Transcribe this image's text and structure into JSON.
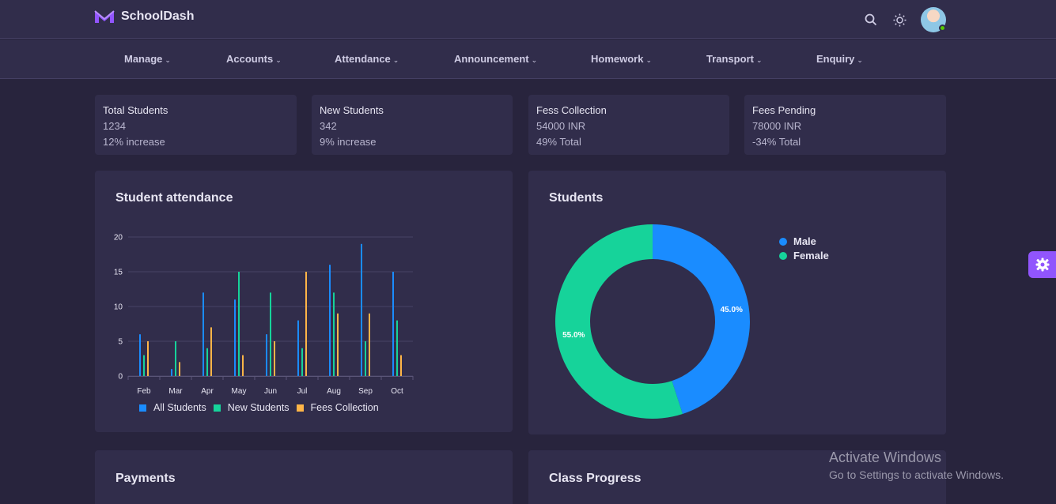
{
  "app": {
    "name": "SchoolDash"
  },
  "nav": [
    {
      "label": "Manage"
    },
    {
      "label": "Accounts"
    },
    {
      "label": "Attendance"
    },
    {
      "label": "Announcement"
    },
    {
      "label": "Homework"
    },
    {
      "label": "Transport"
    },
    {
      "label": "Enquiry"
    }
  ],
  "stats": [
    {
      "label": "Total Students",
      "value": "1234",
      "sub": "12% increase"
    },
    {
      "label": "New Students",
      "value": "342",
      "sub": "9% increase"
    },
    {
      "label": "Fess Collection",
      "value": "54000 INR",
      "sub": "49% Total"
    },
    {
      "label": "Fees Pending",
      "value": "78000 INR",
      "sub": "-34% Total"
    }
  ],
  "cards": {
    "attendance": "Student attendance",
    "students": "Students",
    "payments": "Payments",
    "class_progress": "Class Progress"
  },
  "colors": {
    "blue": "#1a8cff",
    "green": "#16d39a",
    "orange": "#ffb547",
    "accent": "#9155fd"
  },
  "chart_data": [
    {
      "type": "bar",
      "title": "Student attendance",
      "categories": [
        "Feb",
        "Mar",
        "Apr",
        "May",
        "Jun",
        "Jul",
        "Aug",
        "Sep",
        "Oct"
      ],
      "series": [
        {
          "name": "All Students",
          "values": [
            6,
            1,
            12,
            11,
            6,
            8,
            16,
            19,
            15
          ]
        },
        {
          "name": "New Students",
          "values": [
            3,
            5,
            4,
            15,
            12,
            4,
            12,
            5,
            8
          ]
        },
        {
          "name": "Fees Collection",
          "values": [
            5,
            2,
            7,
            3,
            5,
            15,
            9,
            9,
            3
          ]
        }
      ],
      "ylim": [
        0,
        20
      ],
      "yticks": [
        "0",
        "5",
        "10",
        "15",
        "20"
      ],
      "grid": true,
      "legend": "bottom"
    },
    {
      "type": "pie",
      "title": "Students",
      "labels": [
        "Male",
        "Female"
      ],
      "values": [
        45.0,
        55.0
      ],
      "value_labels": [
        "45.0%",
        "55.0%"
      ],
      "legend": "top-right"
    }
  ],
  "watermark": {
    "line1": "Activate Windows",
    "line2": "Go to Settings to activate Windows."
  }
}
